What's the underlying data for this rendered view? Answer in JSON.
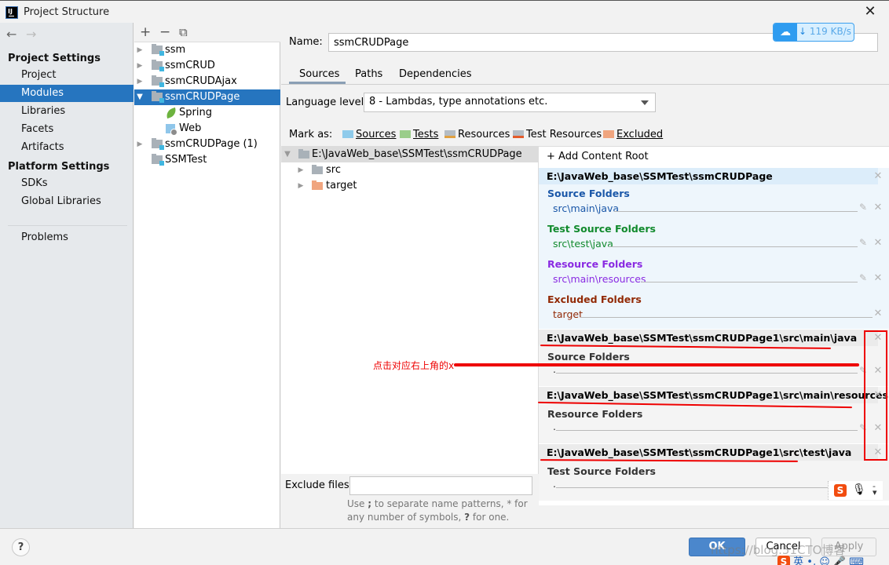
{
  "window": {
    "title": "Project Structure",
    "app_icon_text": "IJ",
    "close_glyph": "✕"
  },
  "nav": {
    "back_glyph": "←",
    "forward_glyph": "→",
    "sections": [
      {
        "title": "Project Settings",
        "items": [
          "Project",
          "Modules",
          "Libraries",
          "Facets",
          "Artifacts"
        ]
      },
      {
        "title": "Platform Settings",
        "items": [
          "SDKs",
          "Global Libraries"
        ]
      }
    ],
    "problems": "Problems",
    "selected": "Modules"
  },
  "modules": {
    "toolbar": {
      "add": "+",
      "remove": "−",
      "copy": "⧉"
    },
    "tree": [
      {
        "label": "ssm",
        "expandable": true,
        "selected": false
      },
      {
        "label": "ssmCRUD",
        "expandable": true,
        "selected": false
      },
      {
        "label": "ssmCRUDAjax",
        "expandable": true,
        "selected": false
      },
      {
        "label": "ssmCRUDPage",
        "expandable": true,
        "expanded": true,
        "selected": true,
        "children": [
          {
            "label": "Spring",
            "icon": "spring-leaf-icon"
          },
          {
            "label": "Web",
            "icon": "web-facet-icon"
          }
        ]
      },
      {
        "label": "ssmCRUDPage (1)",
        "expandable": true,
        "selected": false
      },
      {
        "label": "SSMTest",
        "expandable": false,
        "selected": false
      }
    ]
  },
  "detail": {
    "name_label": "Name:",
    "name_value": "ssmCRUDPage",
    "tabs": [
      "Sources",
      "Paths",
      "Dependencies"
    ],
    "active_tab": "Sources",
    "language_level_label": "Language level:",
    "language_level_value": "8 - Lambdas, type annotations etc.",
    "mark_as_label": "Mark as:",
    "mark_as": [
      {
        "label": "Sources",
        "color": "#8fcbeb"
      },
      {
        "label": "Tests",
        "color": "#9acd8a"
      },
      {
        "label": "Resources",
        "color": "#b4bcc4"
      },
      {
        "label": "Test Resources",
        "color": "#b4bcc4"
      },
      {
        "label": "Excluded",
        "color": "#f0a57f"
      }
    ],
    "dir_tree": [
      {
        "label": "E:\\JavaWeb_base\\SSMTest\\ssmCRUDPage",
        "color": "#a9b1b8",
        "expanded": true
      },
      {
        "label": "src",
        "color": "#a9b1b8"
      },
      {
        "label": "target",
        "color": "#f0a57f"
      }
    ],
    "exclude_files_label": "Exclude files:",
    "exclude_files_value": "",
    "exclude_hint_1": "Use ",
    "exclude_hint_semicolon": ";",
    "exclude_hint_2": " to separate name patterns, * for",
    "exclude_hint_3": "any number of symbols, ",
    "exclude_hint_q": "?",
    "exclude_hint_4": " for one."
  },
  "content_roots": {
    "add_label": "+ Add Content Root",
    "roots": [
      {
        "path": "E:\\JavaWeb_base\\SSMTest\\ssmCRUDPage",
        "sections": [
          {
            "title": "Source Folders",
            "path": "src\\main\\java",
            "color": "#1a57a8"
          },
          {
            "title": "Test Source Folders",
            "path": "src\\test\\java",
            "color": "#118a2d"
          },
          {
            "title": "Resource Folders",
            "path": "src\\main\\resources",
            "color": "#8a2be2"
          },
          {
            "title": "Excluded Folders",
            "path": "target",
            "color": "#922a06"
          }
        ]
      },
      {
        "path": "E:\\JavaWeb_base\\SSMTest\\ssmCRUDPage1\\src\\main\\java",
        "sections": [
          {
            "title": "Source Folders",
            "path": ".",
            "color": "#333333"
          }
        ]
      },
      {
        "path": "E:\\JavaWeb_base\\SSMTest\\ssmCRUDPage1\\src\\main\\resources",
        "sections": [
          {
            "title": "Resource Folders",
            "path": ".",
            "color": "#333333"
          }
        ]
      },
      {
        "path": "E:\\JavaWeb_base\\SSMTest\\ssmCRUDPage1\\src\\test\\java",
        "sections": [
          {
            "title": "Test Source Folders",
            "path": ".",
            "color": "#333333"
          }
        ]
      }
    ]
  },
  "annotation": {
    "text": "点击对应右上角的x",
    "color": "#e00000"
  },
  "overlay": {
    "download_speed": "119 KB/s",
    "watermark": "https://blog.51CTO博客",
    "ime_tray": "英 •, ☺ 🎤 ⌨"
  },
  "buttons": {
    "ok": "OK",
    "cancel": "Cancel",
    "apply": "Apply",
    "help": "?"
  }
}
